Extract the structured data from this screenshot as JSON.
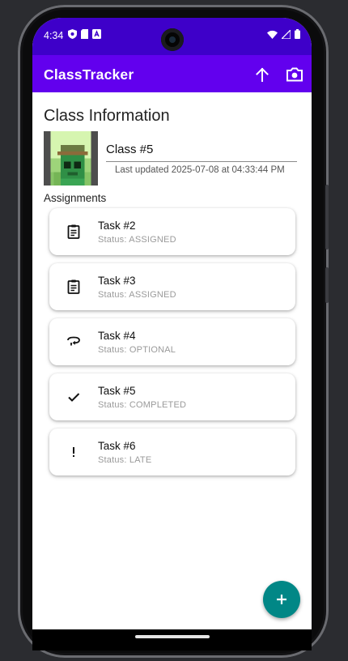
{
  "status_bar": {
    "time": "4:34",
    "left_icons": [
      "shield-icon",
      "sim-icon",
      "a-icon"
    ],
    "right_icons": [
      "wifi-icon",
      "signal-icon",
      "battery-icon"
    ]
  },
  "app_bar": {
    "title": "ClassTracker",
    "actions": [
      "upload-icon",
      "camera-icon"
    ]
  },
  "class_info": {
    "section_title": "Class Information",
    "name_value": "Class #5",
    "last_updated": "Last updated 2025-07-08 at 04:33:44 PM"
  },
  "assignments": {
    "label": "Assignments",
    "items": [
      {
        "name": "Task #2",
        "status": "Status: ASSIGNED",
        "icon": "clipboard-icon"
      },
      {
        "name": "Task #3",
        "status": "Status: ASSIGNED",
        "icon": "clipboard-icon"
      },
      {
        "name": "Task #4",
        "status": "Status: OPTIONAL",
        "icon": "swap-icon"
      },
      {
        "name": "Task #5",
        "status": "Status: COMPLETED",
        "icon": "check-icon"
      },
      {
        "name": "Task #6",
        "status": "Status: LATE",
        "icon": "exclamation-icon"
      }
    ]
  },
  "fab": {
    "icon": "plus-icon"
  },
  "colors": {
    "status_bar": "#3e00c9",
    "app_bar": "#6200ee",
    "fab": "#018786"
  }
}
